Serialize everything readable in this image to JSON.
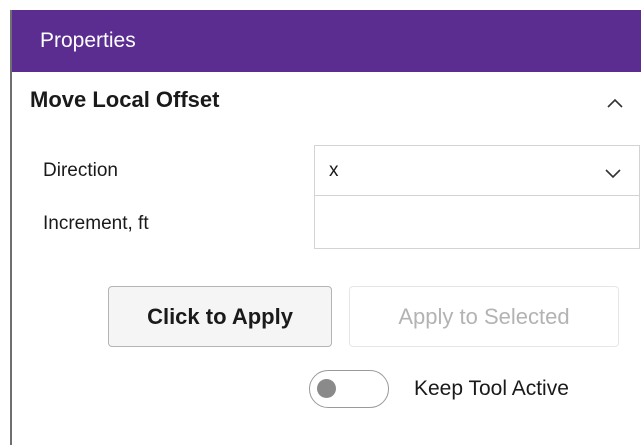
{
  "header": {
    "title": "Properties",
    "background": "#5b2d91"
  },
  "section": {
    "title": "Move Local Offset",
    "collapse_icon": "chevron-up-icon"
  },
  "fields": {
    "direction": {
      "label": "Direction",
      "value": "x",
      "icon": "chevron-down-icon"
    },
    "increment": {
      "label": "Increment, ft",
      "value": ""
    }
  },
  "buttons": {
    "apply": "Click to Apply",
    "apply_selected": "Apply to Selected"
  },
  "toggle": {
    "label": "Keep Tool Active",
    "state": "off"
  }
}
